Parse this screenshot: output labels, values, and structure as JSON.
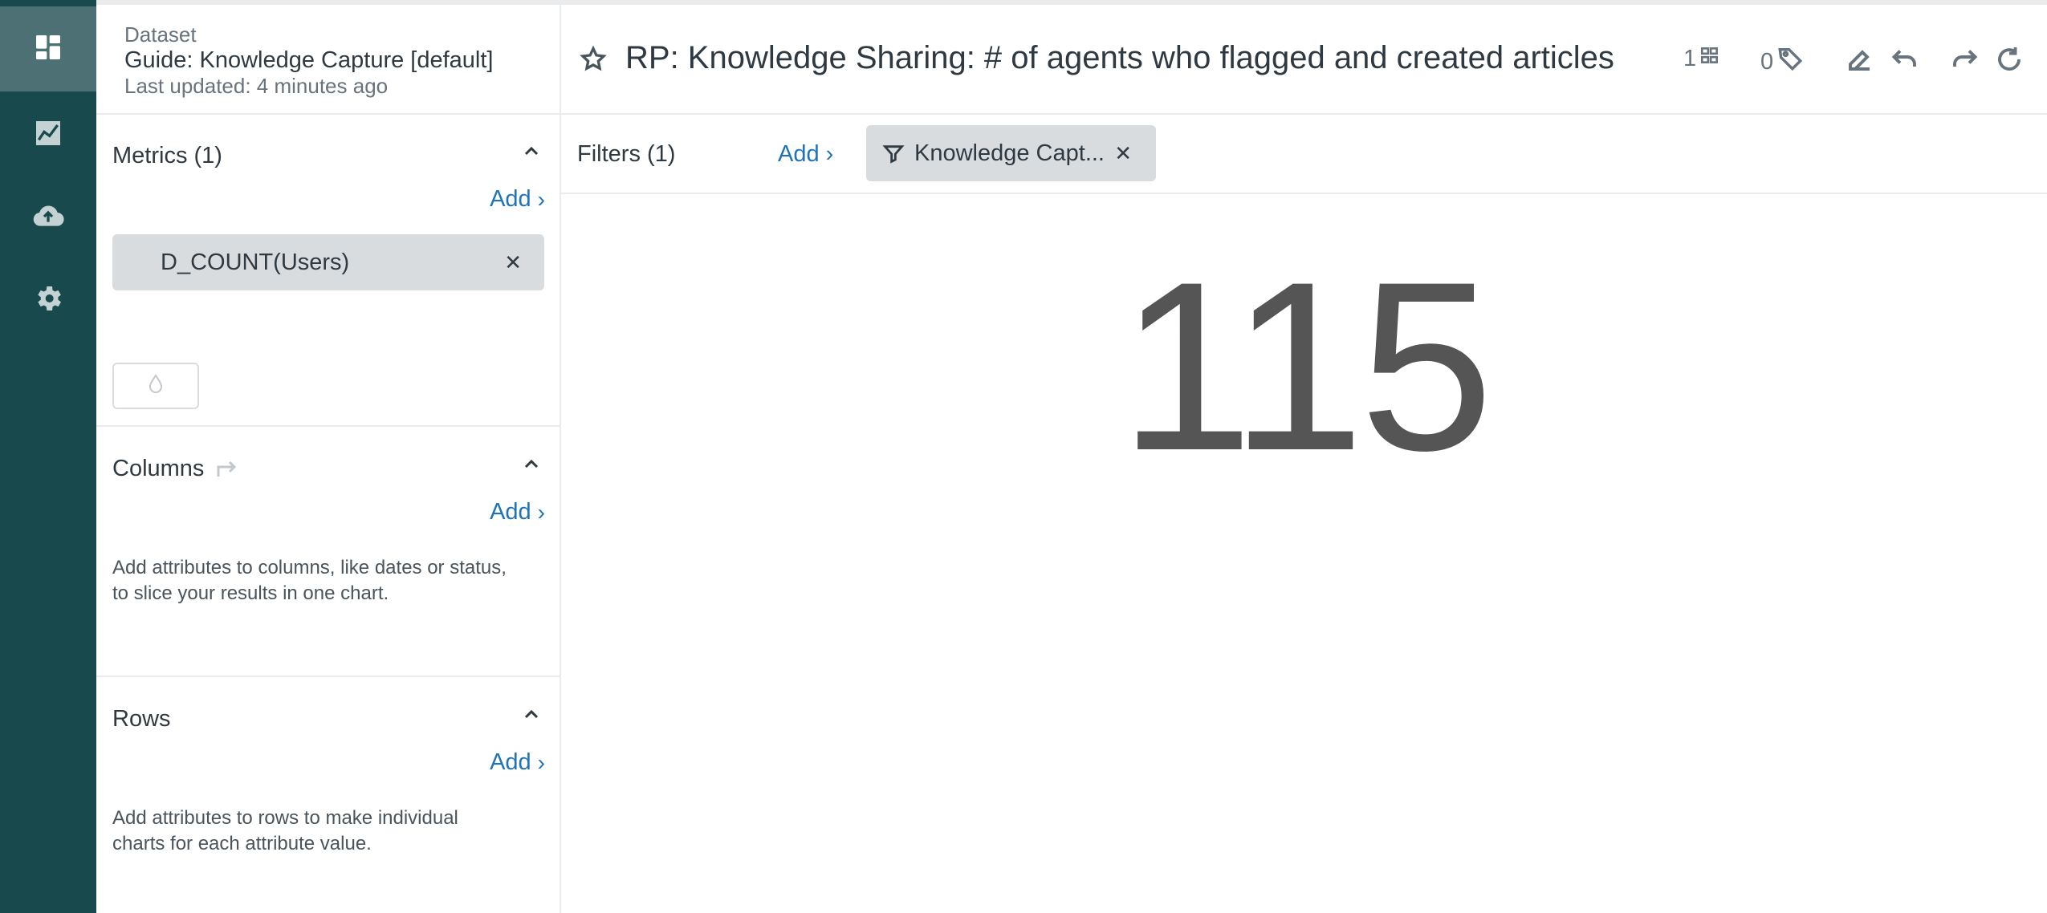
{
  "nav": {
    "items": [
      {
        "icon": "dashboard-icon",
        "active": true
      },
      {
        "icon": "chart-icon",
        "active": false
      },
      {
        "icon": "cloud-upload-icon",
        "active": false
      },
      {
        "icon": "gear-icon",
        "active": false
      }
    ]
  },
  "sidebar": {
    "dataset_label": "Dataset",
    "dataset_name": "Guide: Knowledge Capture [default]",
    "last_updated": "Last updated: 4 minutes ago",
    "metrics": {
      "title": "Metrics (1)",
      "add_label": "Add",
      "items": [
        "D_COUNT(Users)"
      ]
    },
    "columns": {
      "title": "Columns",
      "add_label": "Add",
      "help": "Add attributes to columns, like dates or status, to slice your results in one chart."
    },
    "rows": {
      "title": "Rows",
      "add_label": "Add",
      "help": "Add attributes to rows to make individual charts for each attribute value."
    }
  },
  "header": {
    "title": "RP: Knowledge Sharing: # of agents who flagged and created articles (",
    "dashboards_count": "1",
    "tags_count": "0"
  },
  "filters": {
    "label": "Filters (1)",
    "add_label": "Add",
    "items": [
      "Knowledge Capt..."
    ]
  },
  "result": {
    "value": "115"
  },
  "colors": {
    "nav_bg": "#17494d",
    "nav_active": "#4c7074",
    "link": "#1f73b7",
    "pill_bg": "#d8dcde",
    "kpi_text": "#555555"
  }
}
